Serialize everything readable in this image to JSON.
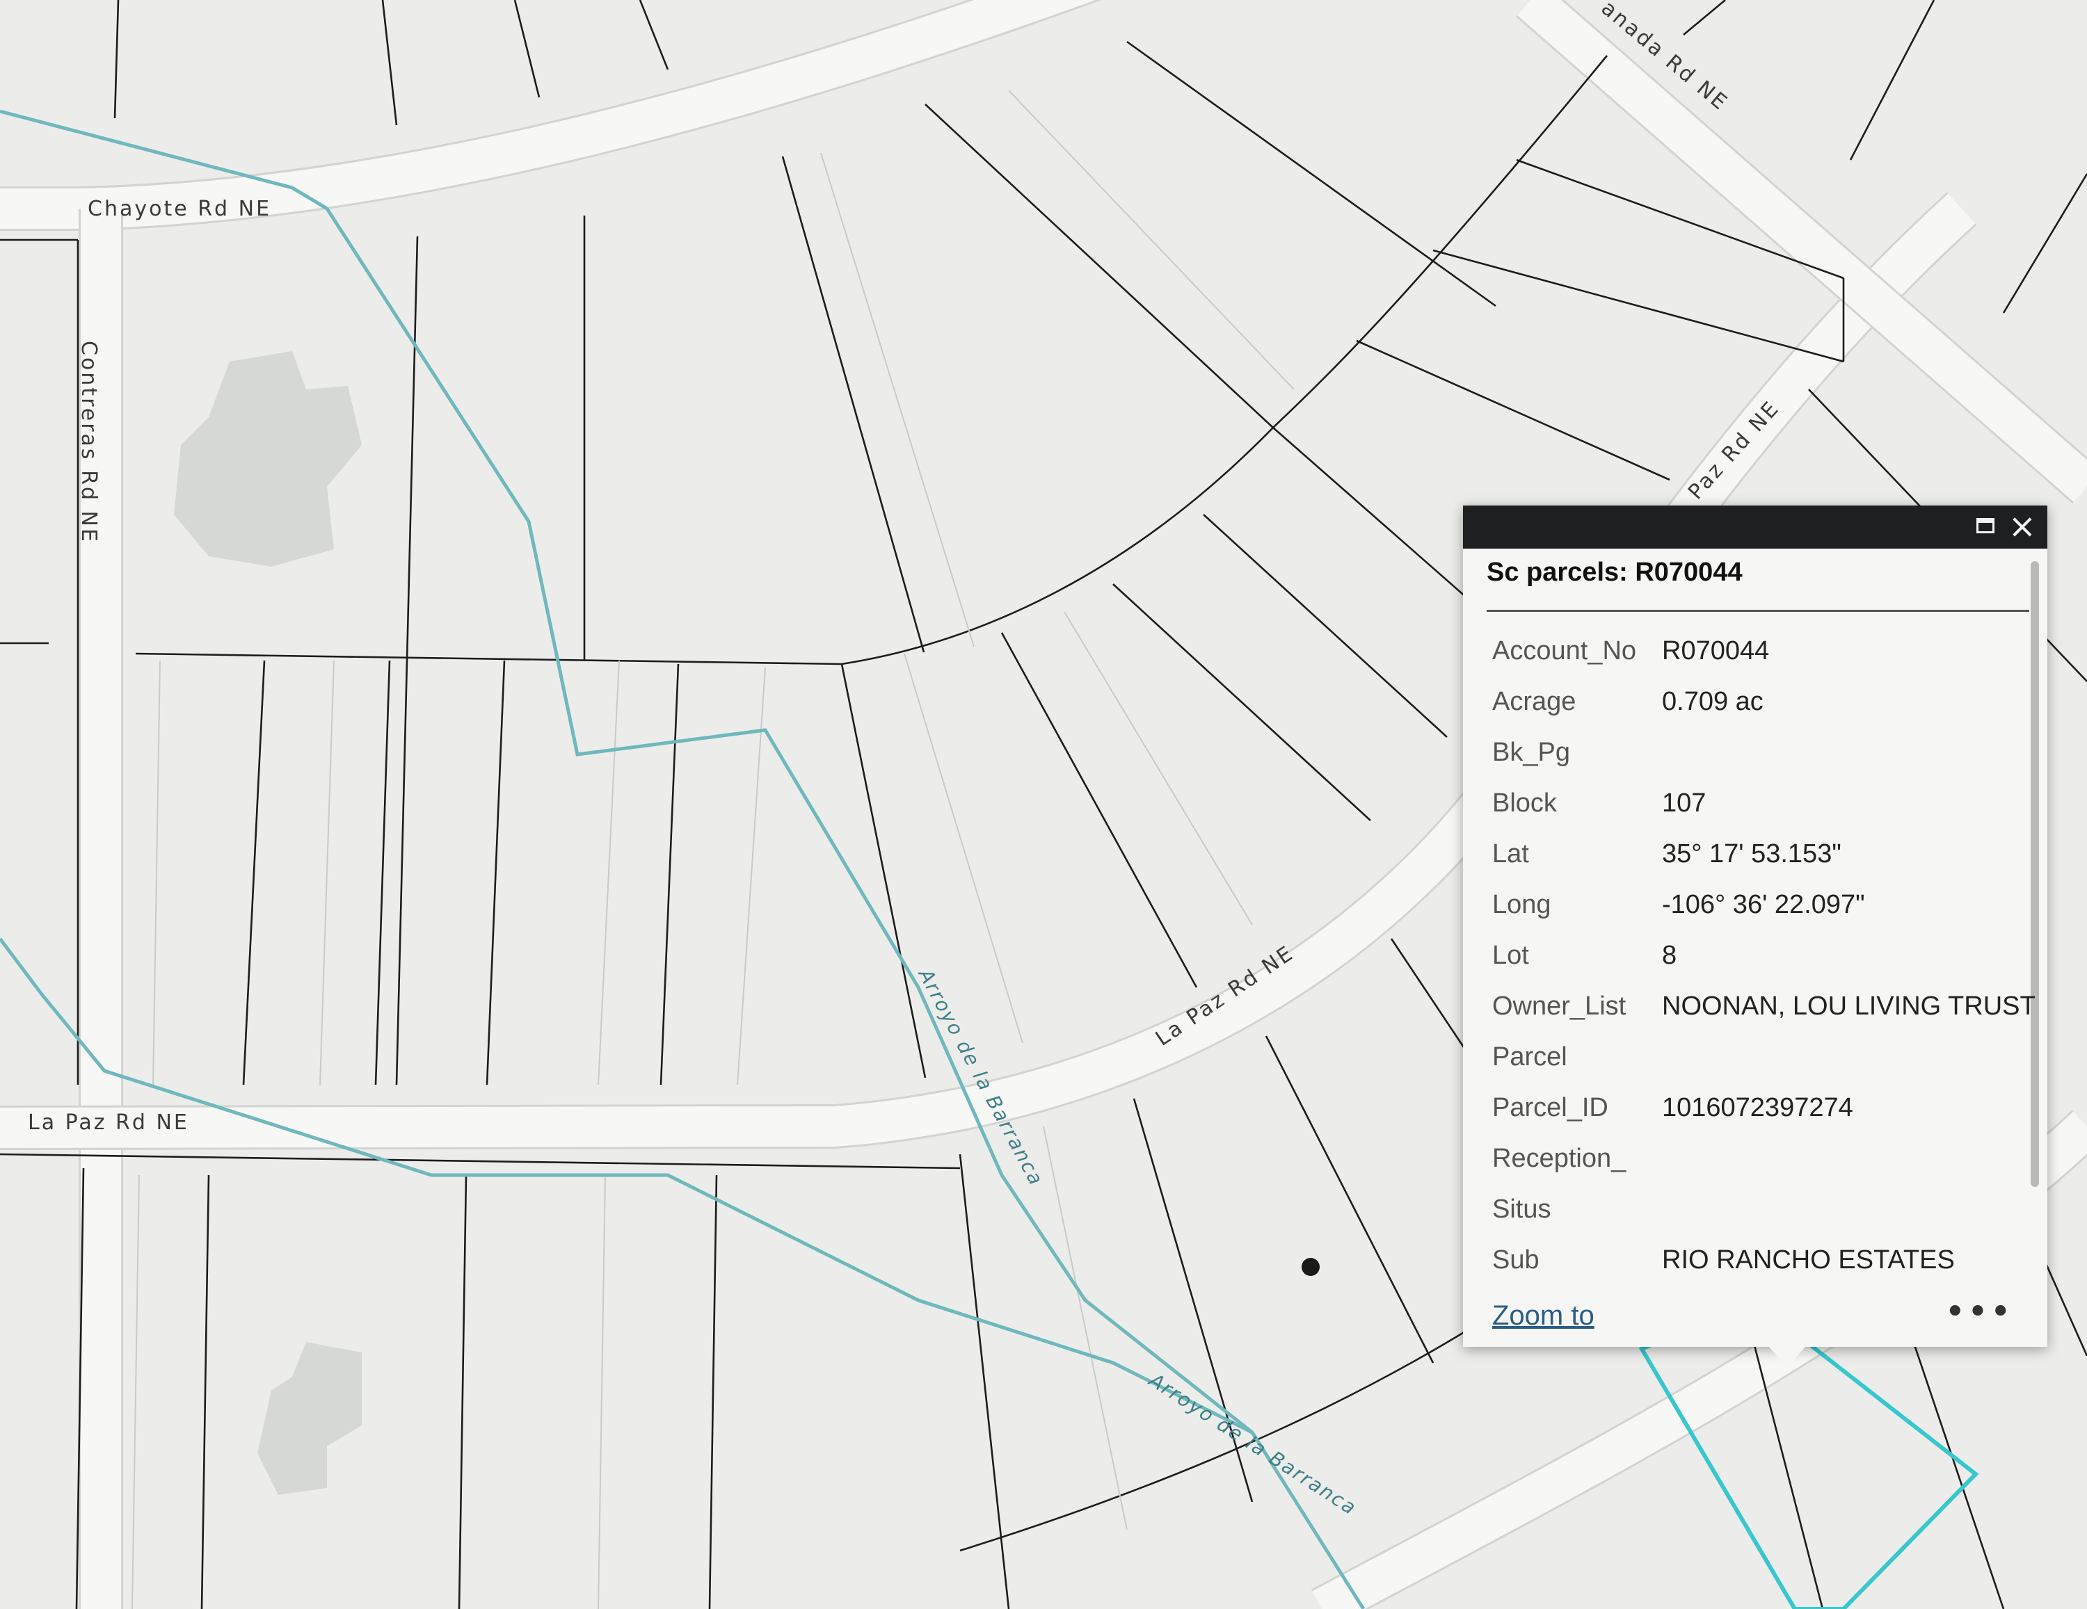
{
  "map": {
    "roads": {
      "chayote": "Chayote Rd NE",
      "contreras": "Contreras Rd NE",
      "la_paz_left": "La Paz Rd NE",
      "la_paz_curve": "La Paz Rd NE",
      "la_paz_right": "Paz Rd NE",
      "canada": "anada Rd NE"
    },
    "arroyo_labels": [
      "Arroyo de la Barranca",
      "Arroyo de la Barranca"
    ],
    "colors": {
      "arroyo": "#6fb8bd",
      "selection": "#36c7cf"
    }
  },
  "popup": {
    "title": "Sc parcels: R070044",
    "fields": [
      {
        "key": "Account_No",
        "value": "R070044"
      },
      {
        "key": "Acrage",
        "value": "0.709 ac"
      },
      {
        "key": "Bk_Pg",
        "value": ""
      },
      {
        "key": "Block",
        "value": "107"
      },
      {
        "key": "Lat",
        "value": "35° 17' 53.153\""
      },
      {
        "key": "Long",
        "value": "-106° 36' 22.097\""
      },
      {
        "key": "Lot",
        "value": "8"
      },
      {
        "key": "Owner_List",
        "value": "NOONAN, LOU LIVING TRUST"
      },
      {
        "key": "Parcel",
        "value": ""
      },
      {
        "key": "Parcel_ID",
        "value": "1016072397274"
      },
      {
        "key": "Reception_",
        "value": ""
      },
      {
        "key": "Situs",
        "value": ""
      },
      {
        "key": "Sub",
        "value": "RIO RANCHO ESTATES"
      }
    ],
    "zoom_label": "Zoom to",
    "more_label": "•••"
  }
}
